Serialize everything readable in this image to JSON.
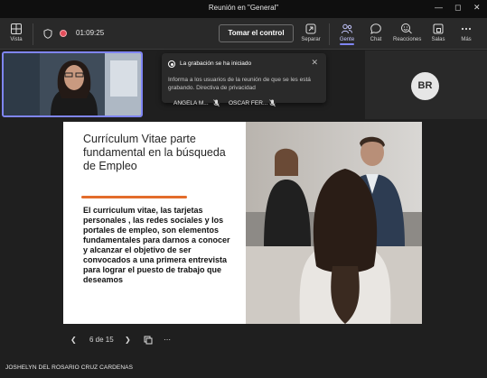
{
  "window": {
    "title": "Reunión en \"General\""
  },
  "toolbar": {
    "view_label": "Vista",
    "timer": "01:09:25",
    "take_control_label": "Tomar el control",
    "items": [
      {
        "label": "Separar",
        "icon": "pop-out-icon"
      },
      {
        "label": "Gente",
        "icon": "people-icon"
      },
      {
        "label": "Chat",
        "icon": "chat-icon"
      },
      {
        "label": "Reacciones",
        "icon": "reactions-icon"
      },
      {
        "label": "Salas",
        "icon": "rooms-icon"
      },
      {
        "label": "Más",
        "icon": "more-icon"
      }
    ]
  },
  "notification": {
    "title": "La grabación se ha iniciado",
    "body": "Informa a los usuarios de la reunión de que se les está grabando. Directiva de privacidad"
  },
  "participants": {
    "names": [
      "ANGELA M...",
      "OSCAR FER..."
    ],
    "avatar_initials": "BR"
  },
  "slide": {
    "title": "Currículum Vitae parte fundamental en la búsqueda de Empleo",
    "body": "El curriculum vitae, las tarjetas personales , las redes sociales y los portales de empleo, son elementos fundamentales para darnos a conocer y alcanzar el objetivo de ser convocados a una primera entrevista para lograr el puesto de trabajo que deseamos",
    "rule_color": "#e36c2b"
  },
  "navigation": {
    "page_indicator": "6 de 15"
  },
  "presenter": {
    "name": "JOSHELYN DEL ROSARIO CRUZ CARDENAS"
  },
  "colors": {
    "accent": "#7f85f5",
    "recording": "#e34d5a",
    "background": "#1f1f1f"
  }
}
